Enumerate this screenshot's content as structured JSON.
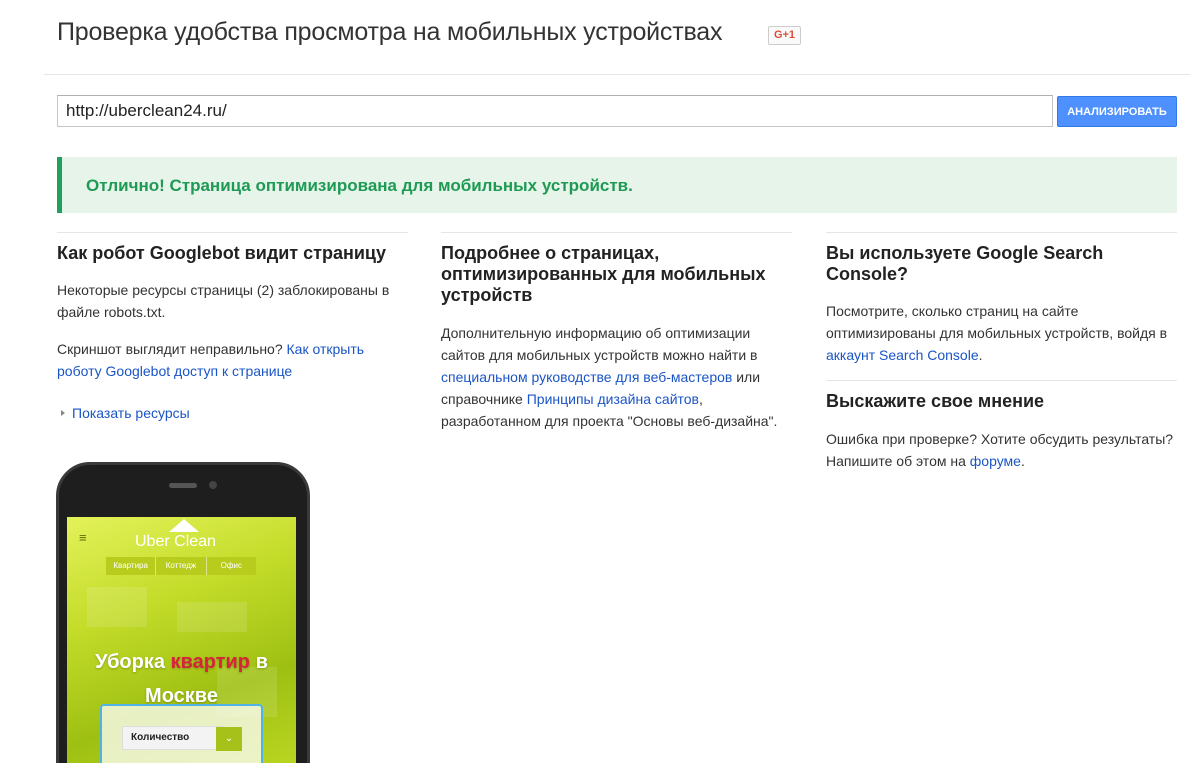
{
  "header": {
    "title": "Проверка удобства просмотра на мобильных устройствах",
    "gplus_label": "G+1"
  },
  "search": {
    "url_value": "http://uberclean24.ru/",
    "analyze_label": "АНАЛИЗИРОВАТЬ"
  },
  "result": {
    "message": "Отлично! Страница оптимизирована для мобильных устройств.",
    "color": "#1f9a55"
  },
  "left_col": {
    "heading": "Как робот Googlebot видит страницу",
    "blocked_line1": "Некоторые ресурсы страницы (2) заблокированы в",
    "blocked_line2": "файле robots.txt.",
    "screenshot_q": "Скриншот выглядит неправильно?",
    "screenshot_link_1": "Как открыть",
    "screenshot_link_2": "роботу Googlebot доступ к странице",
    "show_resources": "Показать ресурсы"
  },
  "mid_col": {
    "heading_1": "Подробнее о страницах,",
    "heading_2": "оптимизированных для мобильных",
    "heading_3": "устройств",
    "line1": "Дополнительную информацию об оптимизации",
    "line2": "сайтов для мобильных устройств можно найти в",
    "link_guide": "специальном руководстве для веб-мастеров",
    "after_guide": "или",
    "before_link2": "справочнике",
    "link_principles": "Принципы дизайна сайтов",
    "after_link2": ",",
    "line5": "разработанном для проекта \"Основы веб-дизайна\"."
  },
  "right_col": {
    "heading_1": "Вы используете Google Search",
    "heading_2": "Console?",
    "line1": "Посмотрите, сколько страниц на сайте",
    "line2": "оптимизированы для мобильных устройств, войдя в",
    "link_account": "аккаунт Search Console",
    "after_account": ".",
    "feedback_heading": "Выскажите свое мнение",
    "fb_line1": "Ошибка при проверке? Хотите обсудить результаты?",
    "fb_before": "Напишите об этом на",
    "fb_link": "форуме",
    "fb_after": "."
  },
  "phone_screen": {
    "menu_icon": "≡",
    "logo_left": "Uber",
    "logo_right": "Clean",
    "nav": [
      "Квартира",
      "Коттедж",
      "Офис"
    ],
    "hero_1": "Уборка",
    "hero_hl": "квартир",
    "hero_2": "в",
    "hero_3": "Москве",
    "qty_label": "Количество",
    "qty_arrow": "⌄"
  }
}
